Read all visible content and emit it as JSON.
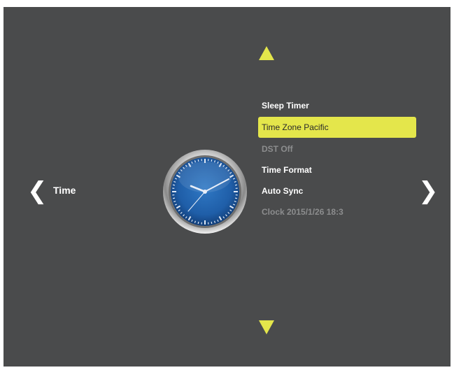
{
  "category": {
    "label": "Time",
    "prev_glyph": "❮",
    "next_glyph": "❯"
  },
  "menu": {
    "items": [
      {
        "label": "Sleep Timer",
        "state": "normal"
      },
      {
        "label": "Time Zone Pacific",
        "state": "selected"
      },
      {
        "label": "DST Off",
        "state": "disabled"
      },
      {
        "label": "Time Format",
        "state": "normal"
      },
      {
        "label": "Auto Sync",
        "state": "normal"
      },
      {
        "label": "Clock 2015/1/26 18:3",
        "state": "disabled"
      }
    ]
  },
  "colors": {
    "background": "#4a4b4c",
    "accent": "#e4e64b",
    "text": "#ffffff",
    "disabled_text": "#8c8d8e",
    "clock_face": "#1f5ea8"
  },
  "icons": {
    "clock": "clock-icon",
    "up": "triangle-up-icon",
    "down": "triangle-down-icon"
  }
}
